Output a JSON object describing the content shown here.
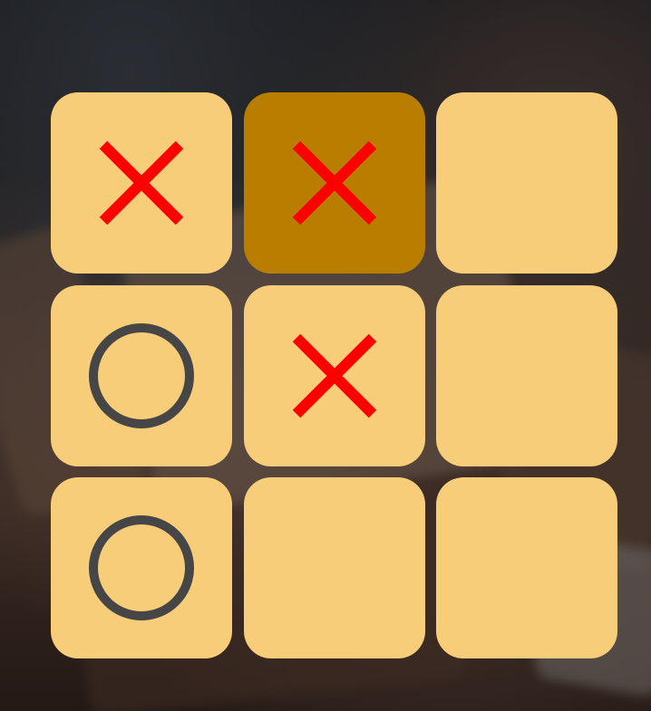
{
  "colors": {
    "cell_background": "#F7CD7A",
    "cell_highlight": "#B97E00",
    "x_mark": "#FF0000",
    "o_mark": "#464646"
  },
  "board": {
    "cells": [
      {
        "mark": "X",
        "highlighted": false
      },
      {
        "mark": "X",
        "highlighted": true
      },
      {
        "mark": "",
        "highlighted": false
      },
      {
        "mark": "O",
        "highlighted": false
      },
      {
        "mark": "X",
        "highlighted": false
      },
      {
        "mark": "",
        "highlighted": false
      },
      {
        "mark": "O",
        "highlighted": false
      },
      {
        "mark": "",
        "highlighted": false
      },
      {
        "mark": "",
        "highlighted": false
      }
    ]
  }
}
